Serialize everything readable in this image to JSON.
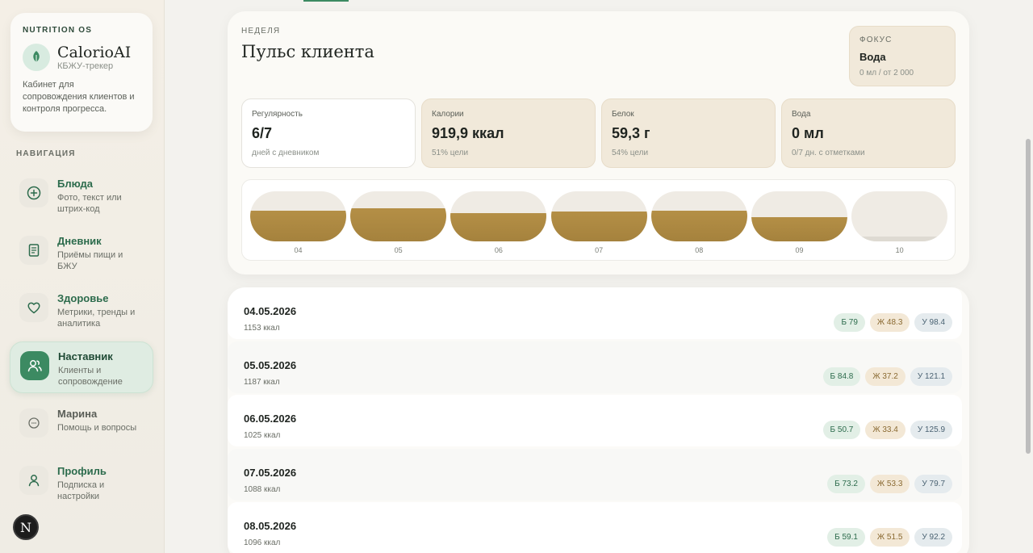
{
  "brand": {
    "os": "NUTRITION OS",
    "name": "CalorioAI",
    "sub": "КБЖУ-трекер",
    "desc": "Кабинет для сопровождения клиентов и контроля прогресса."
  },
  "nav": {
    "title": "НАВИГАЦИЯ",
    "items": [
      {
        "label": "Блюда",
        "desc": "Фото, текст или штрих-код",
        "icon": "plus-circle-icon"
      },
      {
        "label": "Дневник",
        "desc": "Приёмы пищи и БЖУ",
        "icon": "notebook-icon"
      },
      {
        "label": "Здоровье",
        "desc": "Метрики, тренды и аналитика",
        "icon": "heart-icon"
      },
      {
        "label": "Наставник",
        "desc": "Клиенты и сопровождение",
        "icon": "users-icon",
        "active": true
      },
      {
        "label": "Марина",
        "desc": "Помощь и вопросы",
        "icon": "chat-icon"
      },
      {
        "label": "Профиль",
        "desc": "Подписка и настройки",
        "icon": "user-icon"
      }
    ]
  },
  "avatar": "N",
  "pulse": {
    "week": "НЕДЕЛЯ",
    "title": "Пульс клиента",
    "focus": {
      "label": "ФОКУС",
      "value": "Вода",
      "sub": "0 мл / от 2 000"
    },
    "stats": [
      {
        "label": "Регулярность",
        "value": "6/7",
        "sub": "дней с дневником"
      },
      {
        "label": "Калории",
        "value": "919,9 ккал",
        "sub": "51% цели"
      },
      {
        "label": "Белок",
        "value": "59,3 г",
        "sub": "54% цели"
      },
      {
        "label": "Вода",
        "value": "0 мл",
        "sub": "0/7 дн. с отметками"
      }
    ],
    "days": [
      {
        "day": "04",
        "fill": 0.62
      },
      {
        "day": "05",
        "fill": 0.66
      },
      {
        "day": "06",
        "fill": 0.56
      },
      {
        "day": "07",
        "fill": 0.59
      },
      {
        "day": "08",
        "fill": 0.61
      },
      {
        "day": "09",
        "fill": 0.49
      },
      {
        "day": "10",
        "fill": 0.1,
        "empty": true
      }
    ]
  },
  "entries": [
    {
      "date": "04.05.2026",
      "kcal": "1153 ккал",
      "p": "Б 79",
      "f": "Ж 48.3",
      "c": "У 98.4"
    },
    {
      "date": "05.05.2026",
      "kcal": "1187 ккал",
      "p": "Б 84.8",
      "f": "Ж 37.2",
      "c": "У 121.1"
    },
    {
      "date": "06.05.2026",
      "kcal": "1025 ккал",
      "p": "Б 50.7",
      "f": "Ж 33.4",
      "c": "У 125.9"
    },
    {
      "date": "07.05.2026",
      "kcal": "1088 ккал",
      "p": "Б 73.2",
      "f": "Ж 53.3",
      "c": "У 79.7"
    },
    {
      "date": "08.05.2026",
      "kcal": "1096 ккал",
      "p": "Б 59.1",
      "f": "Ж 51.5",
      "c": "У 92.2"
    }
  ]
}
